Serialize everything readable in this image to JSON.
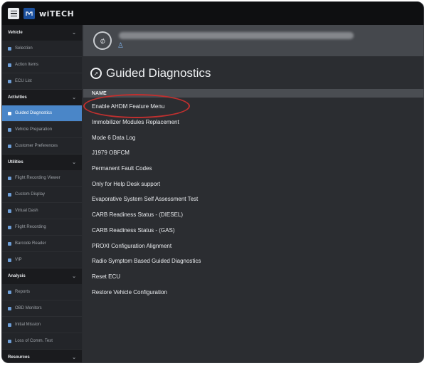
{
  "app": {
    "logo_text": "wiTECH"
  },
  "sidebar": {
    "sections": [
      {
        "title": "Vehicle",
        "items": [
          {
            "label": "Selection",
            "active": false
          },
          {
            "label": "Action Items",
            "active": false
          },
          {
            "label": "ECU List",
            "active": false
          }
        ]
      },
      {
        "title": "Activities",
        "items": [
          {
            "label": "Guided Diagnostics",
            "active": true
          },
          {
            "label": "Vehicle Preparation",
            "active": false
          },
          {
            "label": "Customer Preferences",
            "active": false
          }
        ]
      },
      {
        "title": "Utilities",
        "items": [
          {
            "label": "Flight Recording Viewer",
            "active": false
          },
          {
            "label": "Custom Display",
            "active": false
          },
          {
            "label": "Virtual Dash",
            "active": false
          },
          {
            "label": "Flight Recording",
            "active": false
          },
          {
            "label": "Barcode Reader",
            "active": false
          },
          {
            "label": "VIP",
            "active": false
          }
        ]
      },
      {
        "title": "Analysis",
        "items": [
          {
            "label": "Reports",
            "active": false
          },
          {
            "label": "OBD Monitors",
            "active": false
          },
          {
            "label": "Initial Mission",
            "active": false
          },
          {
            "label": "Loss of Comm. Test",
            "active": false
          }
        ]
      },
      {
        "title": "Resources",
        "items": []
      }
    ]
  },
  "main": {
    "title": "Guided Diagnostics",
    "table_header": "NAME",
    "items": [
      "Enable AHDM Feature Menu",
      "Immobilizer Modules Replacement",
      "Mode 6 Data Log",
      "J1979 OBFCM",
      "Permanent Fault Codes",
      "Only for Help Desk support",
      "Evaporative System Self Assessment Test",
      "CARB Readiness Status - (DIESEL)",
      "CARB Readiness Status - (GAS)",
      "PROXI Configuration Alignment",
      "Radio Symptom Based Guided Diagnostics",
      "Reset ECU",
      "Restore Vehicle Configuration"
    ]
  },
  "colors": {
    "accent": "#4a86c8",
    "annotation": "#c0302f",
    "sidebar_bg": "#232529",
    "main_bg": "#2b2d31"
  }
}
